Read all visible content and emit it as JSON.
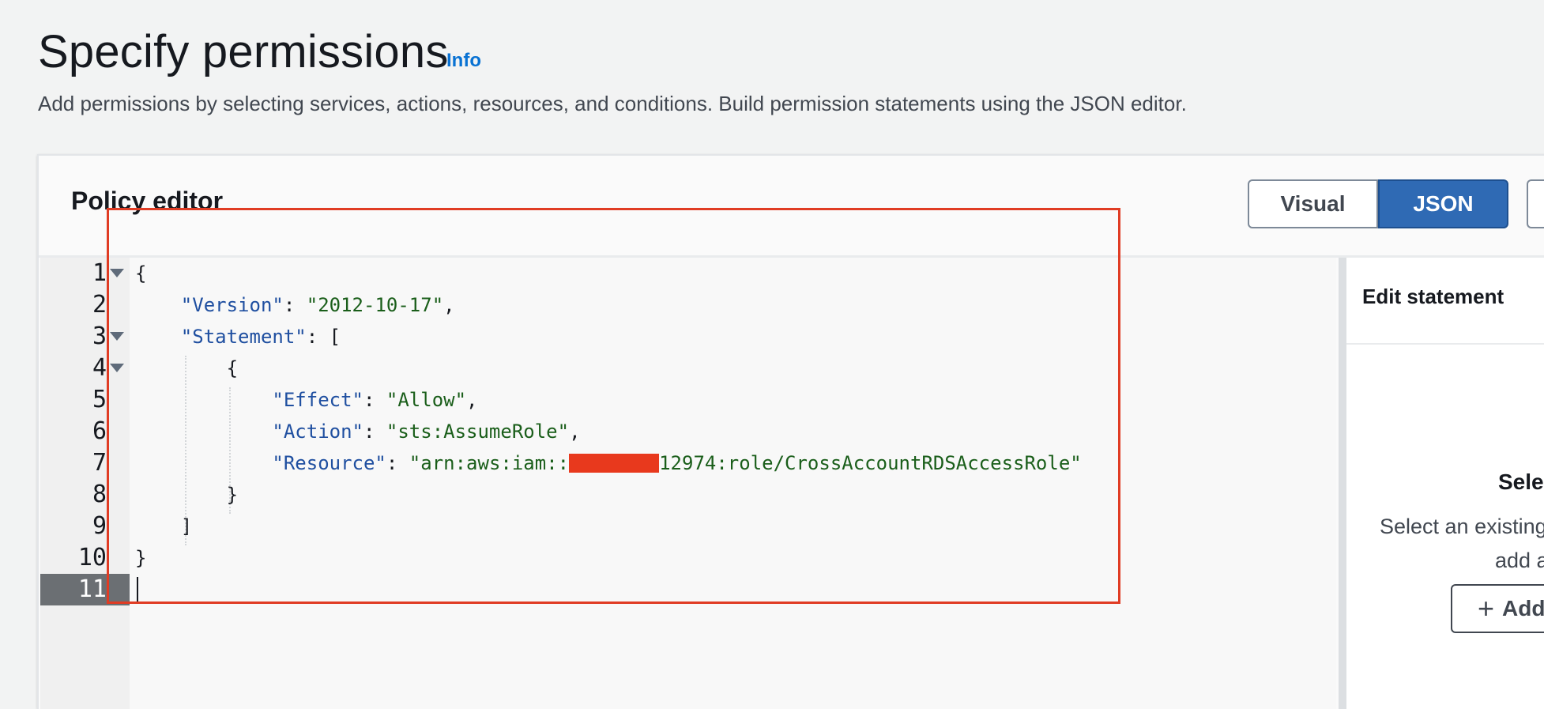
{
  "header": {
    "title": "Specify permissions",
    "info_label": "Info",
    "description": "Add permissions by selecting services, actions, resources, and conditions. Build permission statements using the JSON editor."
  },
  "policy_editor": {
    "title": "Policy editor",
    "modes": {
      "visual": "Visual",
      "json": "JSON",
      "selected": "JSON"
    },
    "lines": [
      {
        "n": "1"
      },
      {
        "n": "2"
      },
      {
        "n": "3"
      },
      {
        "n": "4"
      },
      {
        "n": "5"
      },
      {
        "n": "6"
      },
      {
        "n": "7"
      },
      {
        "n": "8"
      },
      {
        "n": "9"
      },
      {
        "n": "10"
      },
      {
        "n": "11"
      }
    ],
    "code": {
      "l1": "{",
      "version_key": "\"Version\"",
      "version_val": "\"2012-10-17\"",
      "statement_key": "\"Statement\"",
      "open_bracket": "[",
      "open_brace": "{",
      "effect_key": "\"Effect\"",
      "effect_val": "\"Allow\"",
      "action_key": "\"Action\"",
      "action_val": "\"sts:AssumeRole\"",
      "resource_key": "\"Resource\"",
      "resource_val_prefix": "\"arn:aws:iam::",
      "resource_val_suffix": "12974:role/CrossAccountRDSAccessRole\"",
      "close_brace": "}",
      "close_bracket": "]",
      "l10": "}"
    },
    "active_line": "11"
  },
  "side_panel": {
    "title": "Edit statement",
    "select_heading": "Selec",
    "text_line1": "Select an existing",
    "text_line2": "add a",
    "add_button": "Add"
  },
  "colors": {
    "accent": "#0972d3",
    "json_button": "#2f6ab4",
    "annotation": "#e03c24",
    "redaction": "#e8391d"
  }
}
